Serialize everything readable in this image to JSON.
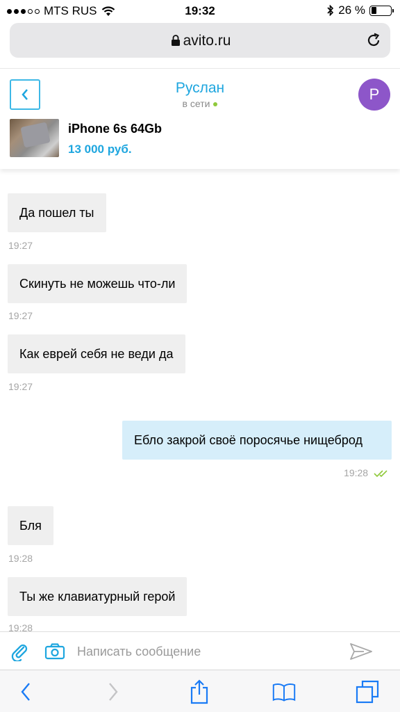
{
  "status_bar": {
    "carrier": "MTS RUS",
    "time": "19:32",
    "battery_percent": "26 %",
    "battery_level": 0.26
  },
  "browser": {
    "url": "avito.ru"
  },
  "chat": {
    "contact_name": "Руслан",
    "contact_status": "в сети",
    "avatar_letter": "Р",
    "product_title": "iPhone 6s 64Gb",
    "product_price": "13 000 руб."
  },
  "messages": [
    {
      "direction": "in",
      "text": "Да пошел ты",
      "time": "19:27"
    },
    {
      "direction": "in",
      "text": "Скинуть не можешь что-ли",
      "time": "19:27"
    },
    {
      "direction": "in",
      "text": "Как еврей себя не веди да",
      "time": "19:27"
    },
    {
      "direction": "out",
      "text": "Ебло закрой своё поросячье нищеброд",
      "time": "19:28",
      "read": true
    },
    {
      "direction": "in",
      "text": "Бля",
      "time": "19:28"
    },
    {
      "direction": "in",
      "text": "Ты же клавиатурный герой",
      "time": "19:28"
    }
  ],
  "composer": {
    "placeholder": "Написать сообщение"
  },
  "colors": {
    "accent": "#1ea6df",
    "online": "#8fc93a",
    "avatar": "#8d56c9",
    "incoming_bubble": "#efefef",
    "outgoing_bubble": "#d6eefa",
    "read_check": "#8fc93a"
  }
}
